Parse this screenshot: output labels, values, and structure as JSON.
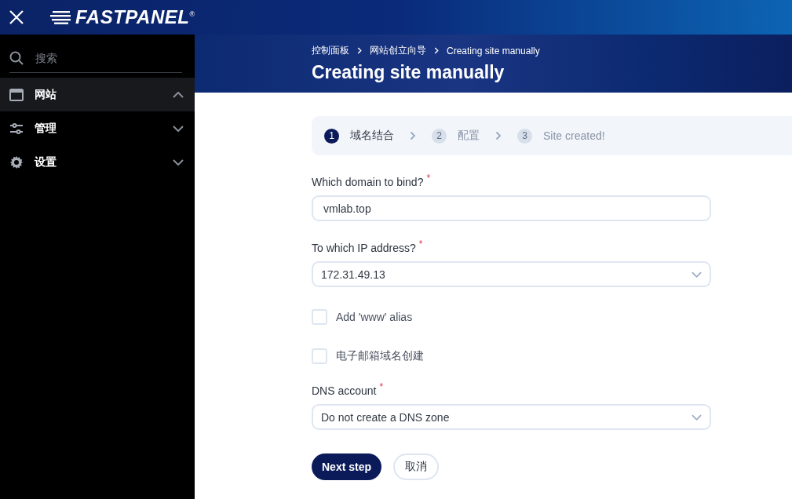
{
  "topbar": {
    "logo": "FASTPANEL$^{®}$"
  },
  "sidebar": {
    "search": {
      "placeholder": "搜索"
    },
    "items": [
      {
        "label": "网站",
        "kind": "browser",
        "expanded": true
      },
      {
        "label": "管理",
        "kind": "sliders",
        "expanded": false
      },
      {
        "label": "设置",
        "kind": "gear",
        "expanded": false
      }
    ]
  },
  "header": {
    "breadcrumbs": [
      "控制面板",
      "网站创立向导",
      "Creating site manually"
    ],
    "title": "Creating site manually"
  },
  "steps": [
    {
      "number": "1",
      "label": "域名结合",
      "selected": true
    },
    {
      "number": "2",
      "label": "配置",
      "selected": false
    },
    {
      "number": "3",
      "label": "Site created!",
      "selected": false
    }
  ],
  "fields": [
    {
      "kind": "text",
      "label": "Which domain to bind?",
      "required_mark": "*",
      "value": "vmlab.top"
    },
    {
      "kind": "select",
      "label": "To which IP address?",
      "required_mark": "*",
      "value": "172.31.49.13"
    },
    {
      "kind": "checkbox",
      "label": "Add 'www' alias",
      "checked": false
    },
    {
      "kind": "checkbox",
      "label": "电子邮箱域名创建",
      "checked": false
    },
    {
      "kind": "select",
      "label": "DNS account",
      "required_mark": "*",
      "value": "Do not create a DNS zone"
    }
  ],
  "buttons": [
    {
      "label": "Next step",
      "kind": "primary"
    },
    {
      "label": "取消",
      "kind": "secondary"
    }
  ]
}
